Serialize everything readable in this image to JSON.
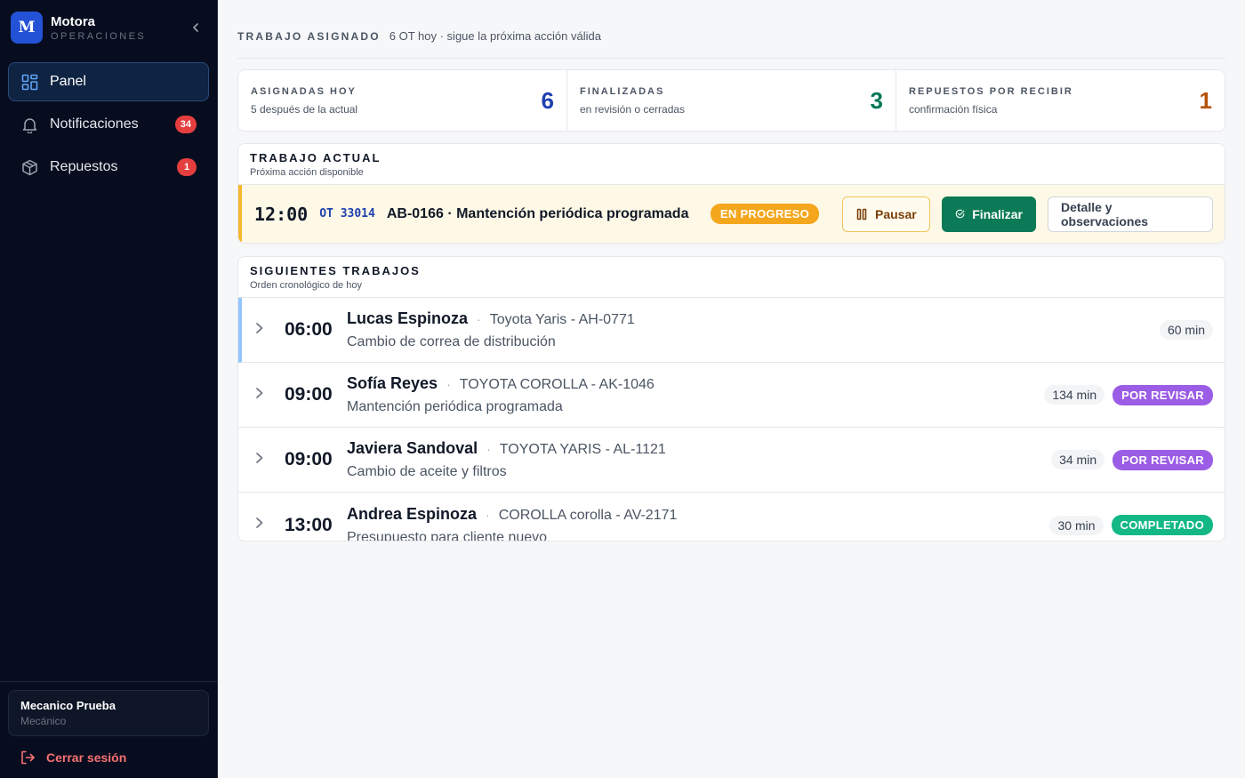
{
  "brand": {
    "logo": "M",
    "name": "Motora",
    "sub": "OPERACIONES"
  },
  "nav": [
    {
      "label": "Panel",
      "icon": "grid-icon",
      "badge": null
    },
    {
      "label": "Notificaciones",
      "icon": "bell-icon",
      "badge": "34"
    },
    {
      "label": "Repuestos",
      "icon": "box-icon",
      "badge": "1"
    }
  ],
  "user": {
    "name": "Mecanico Prueba",
    "role": "Mecánico"
  },
  "logout_label": "Cerrar sesión",
  "header": {
    "title": "TRABAJO ASIGNADO",
    "sub": "6 OT hoy · sigue la próxima acción válida"
  },
  "stats": [
    {
      "label": "ASIGNADAS HOY",
      "sub": "5 después de la actual",
      "value": "6",
      "color": "#1e40af"
    },
    {
      "label": "FINALIZADAS",
      "sub": "en revisión o cerradas",
      "value": "3",
      "color": "#047857"
    },
    {
      "label": "REPUESTOS POR RECIBIR",
      "sub": "confirmación física",
      "value": "1",
      "color": "#b45309"
    }
  ],
  "current": {
    "title": "TRABAJO ACTUAL",
    "sub": "Próxima acción disponible",
    "time": "12:00",
    "ot": "OT 33014",
    "job_title": "AB-0166 · Mantención periódica programada",
    "status": "EN PROGRESO",
    "pause_label": "Pausar",
    "finish_label": "Finalizar",
    "detail_label": "Detalle y observaciones"
  },
  "next": {
    "title": "SIGUIENTES TRABAJOS",
    "sub": "Orden cronológico de hoy",
    "jobs": [
      {
        "time": "06:00",
        "name": "Lucas Espinoza",
        "vehicle": "Toyota Yaris - AH-0771",
        "desc": "Cambio de correa de distribución",
        "duration": "60 min",
        "status": ""
      },
      {
        "time": "09:00",
        "name": "Sofía Reyes",
        "vehicle": "TOYOTA COROLLA - AK-1046",
        "desc": "Mantención periódica programada",
        "duration": "134 min",
        "status": "POR REVISAR"
      },
      {
        "time": "09:00",
        "name": "Javiera Sandoval",
        "vehicle": "TOYOTA YARIS - AL-1121",
        "desc": "Cambio de aceite y filtros",
        "duration": "34 min",
        "status": "POR REVISAR"
      },
      {
        "time": "13:00",
        "name": "Andrea Espinoza",
        "vehicle": "COROLLA corolla - AV-2171",
        "desc": "Presupuesto para cliente nuevo",
        "duration": "30 min",
        "status": "COMPLETADO"
      }
    ]
  }
}
